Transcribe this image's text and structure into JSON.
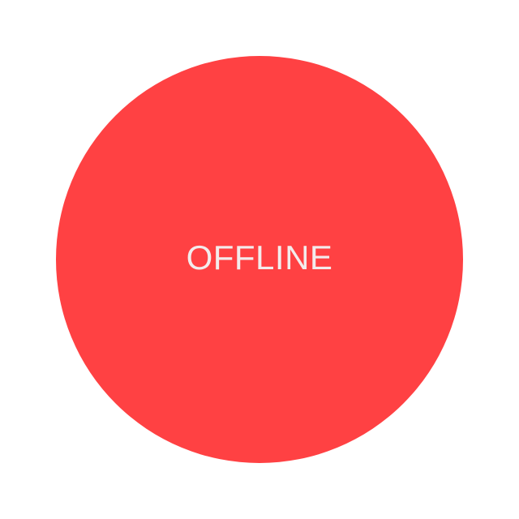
{
  "status": {
    "label": "OFFLINE",
    "color": "#ff4143",
    "text_color": "#f3ecec"
  }
}
